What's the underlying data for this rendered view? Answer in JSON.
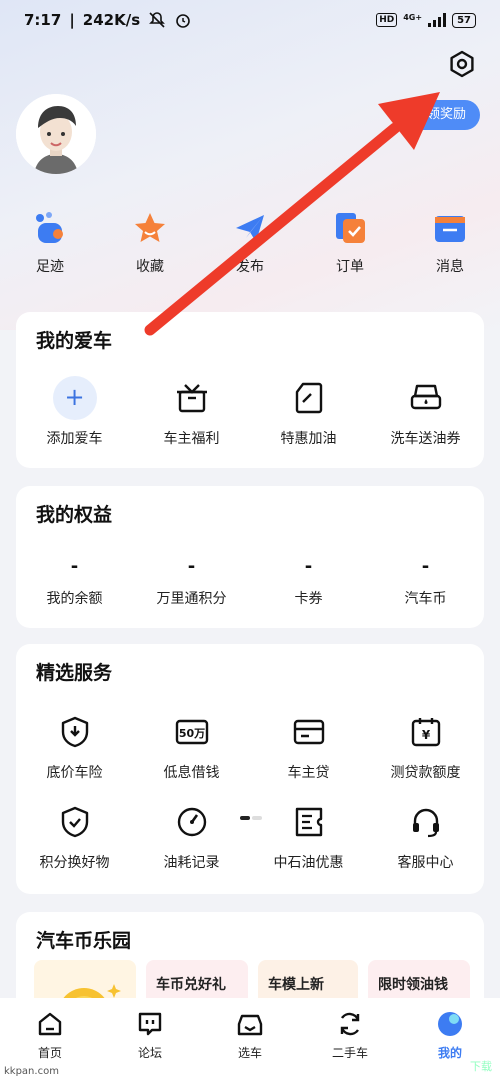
{
  "status_bar": {
    "time": "7:17",
    "speed": "242K/s",
    "network": "4G+",
    "battery": "57",
    "hd": "HD"
  },
  "header": {
    "reward_label": "领奖励",
    "icons": [
      "settings-icon",
      "avatar"
    ]
  },
  "quick_links": [
    {
      "label": "足迹",
      "icon": "footprint-icon",
      "color": "#3d7cf2"
    },
    {
      "label": "收藏",
      "icon": "star-icon",
      "color": "#f5813a"
    },
    {
      "label": "发布",
      "icon": "send-icon",
      "color": "#3d7cf2"
    },
    {
      "label": "订单",
      "icon": "order-icon",
      "color": "#f5813a"
    },
    {
      "label": "消息",
      "icon": "message-icon",
      "color": "#3d7cf2"
    }
  ],
  "my_car": {
    "title": "我的爱车",
    "items": [
      {
        "label": "添加爱车",
        "icon": "plus-icon"
      },
      {
        "label": "车主福利",
        "icon": "gift-box-icon"
      },
      {
        "label": "特惠加油",
        "icon": "fuel-can-icon"
      },
      {
        "label": "洗车送油券",
        "icon": "car-wash-icon"
      }
    ]
  },
  "my_rights": {
    "title": "我的权益",
    "items": [
      {
        "value": "-",
        "label": "我的余额"
      },
      {
        "value": "-",
        "label": "万里通积分"
      },
      {
        "value": "-",
        "label": "卡券"
      },
      {
        "value": "-",
        "label": "汽车币"
      }
    ]
  },
  "services": {
    "title": "精选服务",
    "row1": [
      {
        "label": "底价车险",
        "icon": "shield-down-icon"
      },
      {
        "label": "低息借钱",
        "icon": "50wan-icon",
        "badge": "50万"
      },
      {
        "label": "车主贷",
        "icon": "card-icon"
      },
      {
        "label": "测贷款额度",
        "icon": "calendar-yen-icon",
        "badge": "¥"
      }
    ],
    "row2": [
      {
        "label": "积分换好物",
        "icon": "shield-check-icon"
      },
      {
        "label": "油耗记录",
        "icon": "gauge-icon"
      },
      {
        "label": "中石油优惠",
        "icon": "voucher-icon"
      },
      {
        "label": "客服中心",
        "icon": "headset-icon"
      }
    ]
  },
  "coin_park": {
    "title": "汽车币乐园",
    "promos": [
      "车币兑好礼",
      "车模上新",
      "限时领油钱"
    ]
  },
  "tabbar": [
    {
      "label": "首页",
      "icon": "home-icon"
    },
    {
      "label": "论坛",
      "icon": "forum-icon"
    },
    {
      "label": "选车",
      "icon": "car-select-icon"
    },
    {
      "label": "二手车",
      "icon": "exchange-icon"
    },
    {
      "label": "我的",
      "icon": "profile-icon"
    }
  ],
  "watermark": "kkpan.com",
  "watermark2": "下载",
  "colors": {
    "accent": "#3d7cf2",
    "arrow": "#ee3b2a",
    "orange": "#f5813a"
  }
}
